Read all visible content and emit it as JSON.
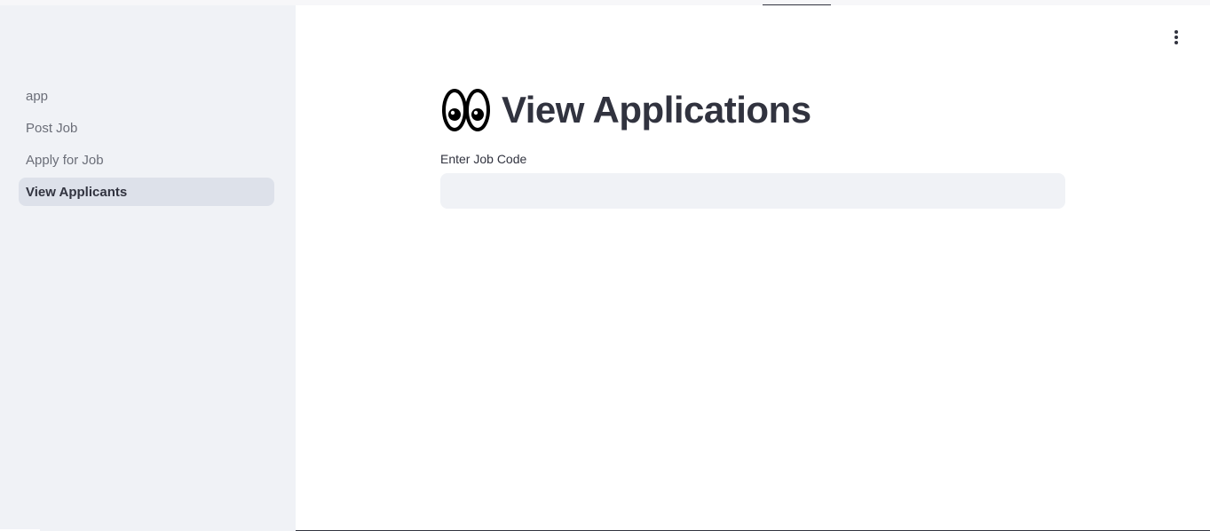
{
  "sidebar": {
    "items": [
      {
        "label": "app",
        "active": false
      },
      {
        "label": "Post Job",
        "active": false
      },
      {
        "label": "Apply for Job",
        "active": false
      },
      {
        "label": "View Applicants",
        "active": true
      }
    ]
  },
  "header": {
    "menu_icon": "vertical-ellipsis-icon"
  },
  "main": {
    "title_icon": "eyes-icon",
    "title": "View Applications",
    "job_code_field": {
      "label": "Enter Job Code",
      "value": "",
      "placeholder": ""
    }
  },
  "colors": {
    "sidebar_bg": "#f0f2f6",
    "active_item_bg": "#dde1ea",
    "text": "#31333f",
    "muted_text": "#6b6e78",
    "input_bg": "#f0f2f6"
  }
}
